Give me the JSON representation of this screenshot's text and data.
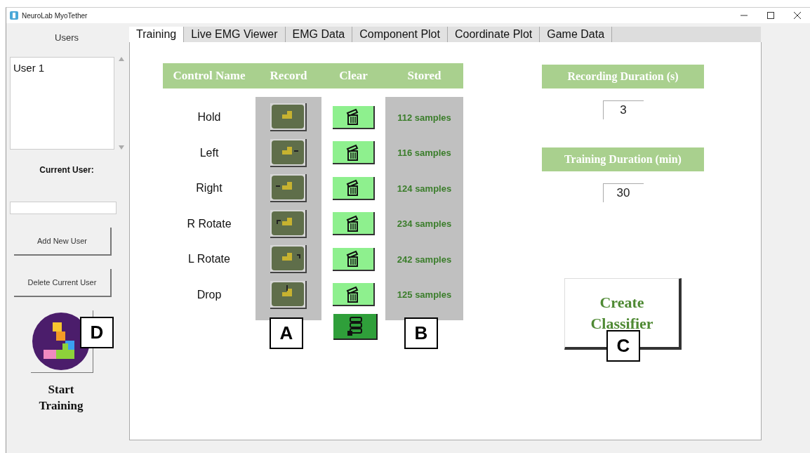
{
  "window": {
    "title": "NeuroLab MyoTether"
  },
  "sidebar": {
    "heading": "Users",
    "users": [
      {
        "name": "User 1",
        "selected": false
      }
    ],
    "current_user_label": "Current User:",
    "buttons": [
      "Add New User",
      "Delete Current User"
    ],
    "start_label": "Start Training"
  },
  "tabs": [
    {
      "label": "Training",
      "selected": true
    },
    {
      "label": "Live EMG Viewer",
      "selected": false
    },
    {
      "label": "EMG Data",
      "selected": false
    },
    {
      "label": "Component Plot",
      "selected": false
    },
    {
      "label": "Coordinate Plot",
      "selected": false
    },
    {
      "label": "Game Data",
      "selected": false
    }
  ],
  "training": {
    "columns": [
      "Control Name",
      "Record",
      "Clear",
      "Stored"
    ],
    "controls": [
      {
        "name": "Hold",
        "stored": "112 samples"
      },
      {
        "name": "Left",
        "stored": "116 samples"
      },
      {
        "name": "Right",
        "stored": "124 samples"
      },
      {
        "name": "R Rotate",
        "stored": "234 samples"
      },
      {
        "name": "L Rotate",
        "stored": "242 samples"
      },
      {
        "name": "Drop",
        "stored": "125 samples"
      }
    ],
    "settings": [
      {
        "label": "Recording Duration (s)",
        "value": "3"
      },
      {
        "label": "Training Duration (min)",
        "value": "30"
      }
    ],
    "create_button": "Create Classifier"
  },
  "annotations": [
    {
      "label": "A"
    },
    {
      "label": "B"
    },
    {
      "label": "C"
    },
    {
      "label": "D"
    }
  ]
}
